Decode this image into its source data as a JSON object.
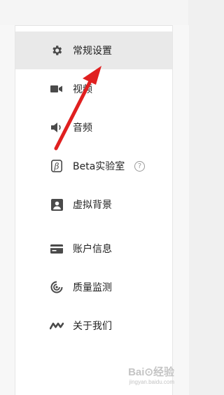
{
  "menu": [
    {
      "label": "常规设置",
      "icon": "gear-icon",
      "selected": true
    },
    {
      "label": "视频",
      "icon": "video-camera-icon"
    },
    {
      "label": "音频",
      "icon": "speaker-icon"
    },
    {
      "label": "Beta实验室",
      "icon": "beta-icon",
      "help": "?"
    },
    {
      "label": "虚拟背景",
      "icon": "portrait-icon"
    },
    {
      "label": "账户信息",
      "icon": "card-icon"
    },
    {
      "label": "质量监测",
      "icon": "monitor-gauge-icon"
    },
    {
      "label": "关于我们",
      "icon": "logo-icon"
    }
  ],
  "watermark": {
    "logo": "Bai⊙经验",
    "site": "jingyan.baidu.com"
  },
  "colors": {
    "icon": "#4a4a4a",
    "arrow": "#e02020",
    "selected_bg": "#e9e9e9"
  }
}
